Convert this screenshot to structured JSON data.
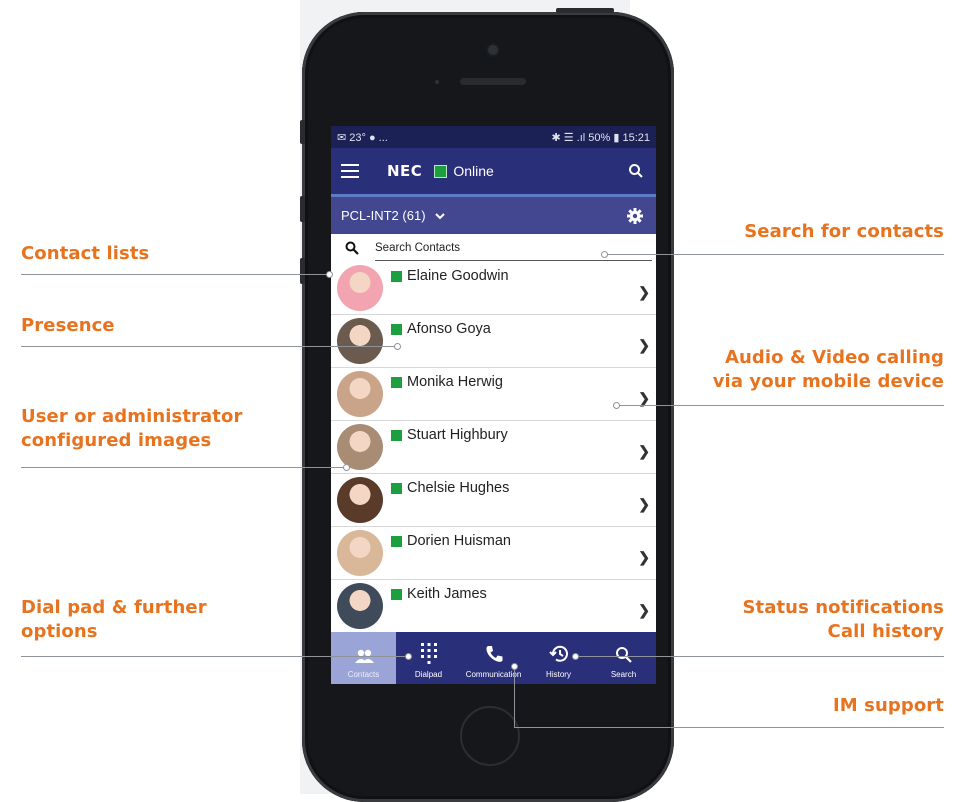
{
  "callouts": {
    "contact_lists": "Contact lists",
    "presence": "Presence",
    "images_line1": "User or administrator",
    "images_line2": "configured images",
    "dialpad_line1": "Dial pad & further",
    "dialpad_line2": "options",
    "search_contacts": "Search for contacts",
    "av_line1": "Audio & Video calling",
    "av_line2": "via your mobile device",
    "status_line1": "Status notifications",
    "status_line2": "Call history",
    "im_support": "IM support"
  },
  "statusbar": {
    "left": "✉ 23° ● ...",
    "right": "✱ ☰ .ıl 50% ▮ 15:21"
  },
  "header": {
    "logo": "NEC",
    "status": "Online"
  },
  "subheader": {
    "list_name": "PCL-INT2 (61)"
  },
  "search": {
    "placeholder": "Search Contacts"
  },
  "contacts": [
    {
      "name": "Elaine Goodwin",
      "color": "#f2a4b0"
    },
    {
      "name": "Afonso Goya",
      "color": "#6b5a4e"
    },
    {
      "name": "Monika Herwig",
      "color": "#c9a489"
    },
    {
      "name": "Stuart Highbury",
      "color": "#a88c74"
    },
    {
      "name": "Chelsie Hughes",
      "color": "#5a3b2a"
    },
    {
      "name": "Dorien Huisman",
      "color": "#d8b898"
    },
    {
      "name": "Keith James",
      "color": "#3f4b5a"
    }
  ],
  "tabs": [
    {
      "label": "Contacts",
      "icon": "contacts-icon"
    },
    {
      "label": "Dialpad",
      "icon": "dialpad-icon"
    },
    {
      "label": "Communication",
      "icon": "phone-icon"
    },
    {
      "label": "History",
      "icon": "history-icon"
    },
    {
      "label": "Search",
      "icon": "search-icon"
    }
  ],
  "colors": {
    "accent": "#e8731f",
    "header": "#2a2f79",
    "presence": "#1c9f3f"
  }
}
